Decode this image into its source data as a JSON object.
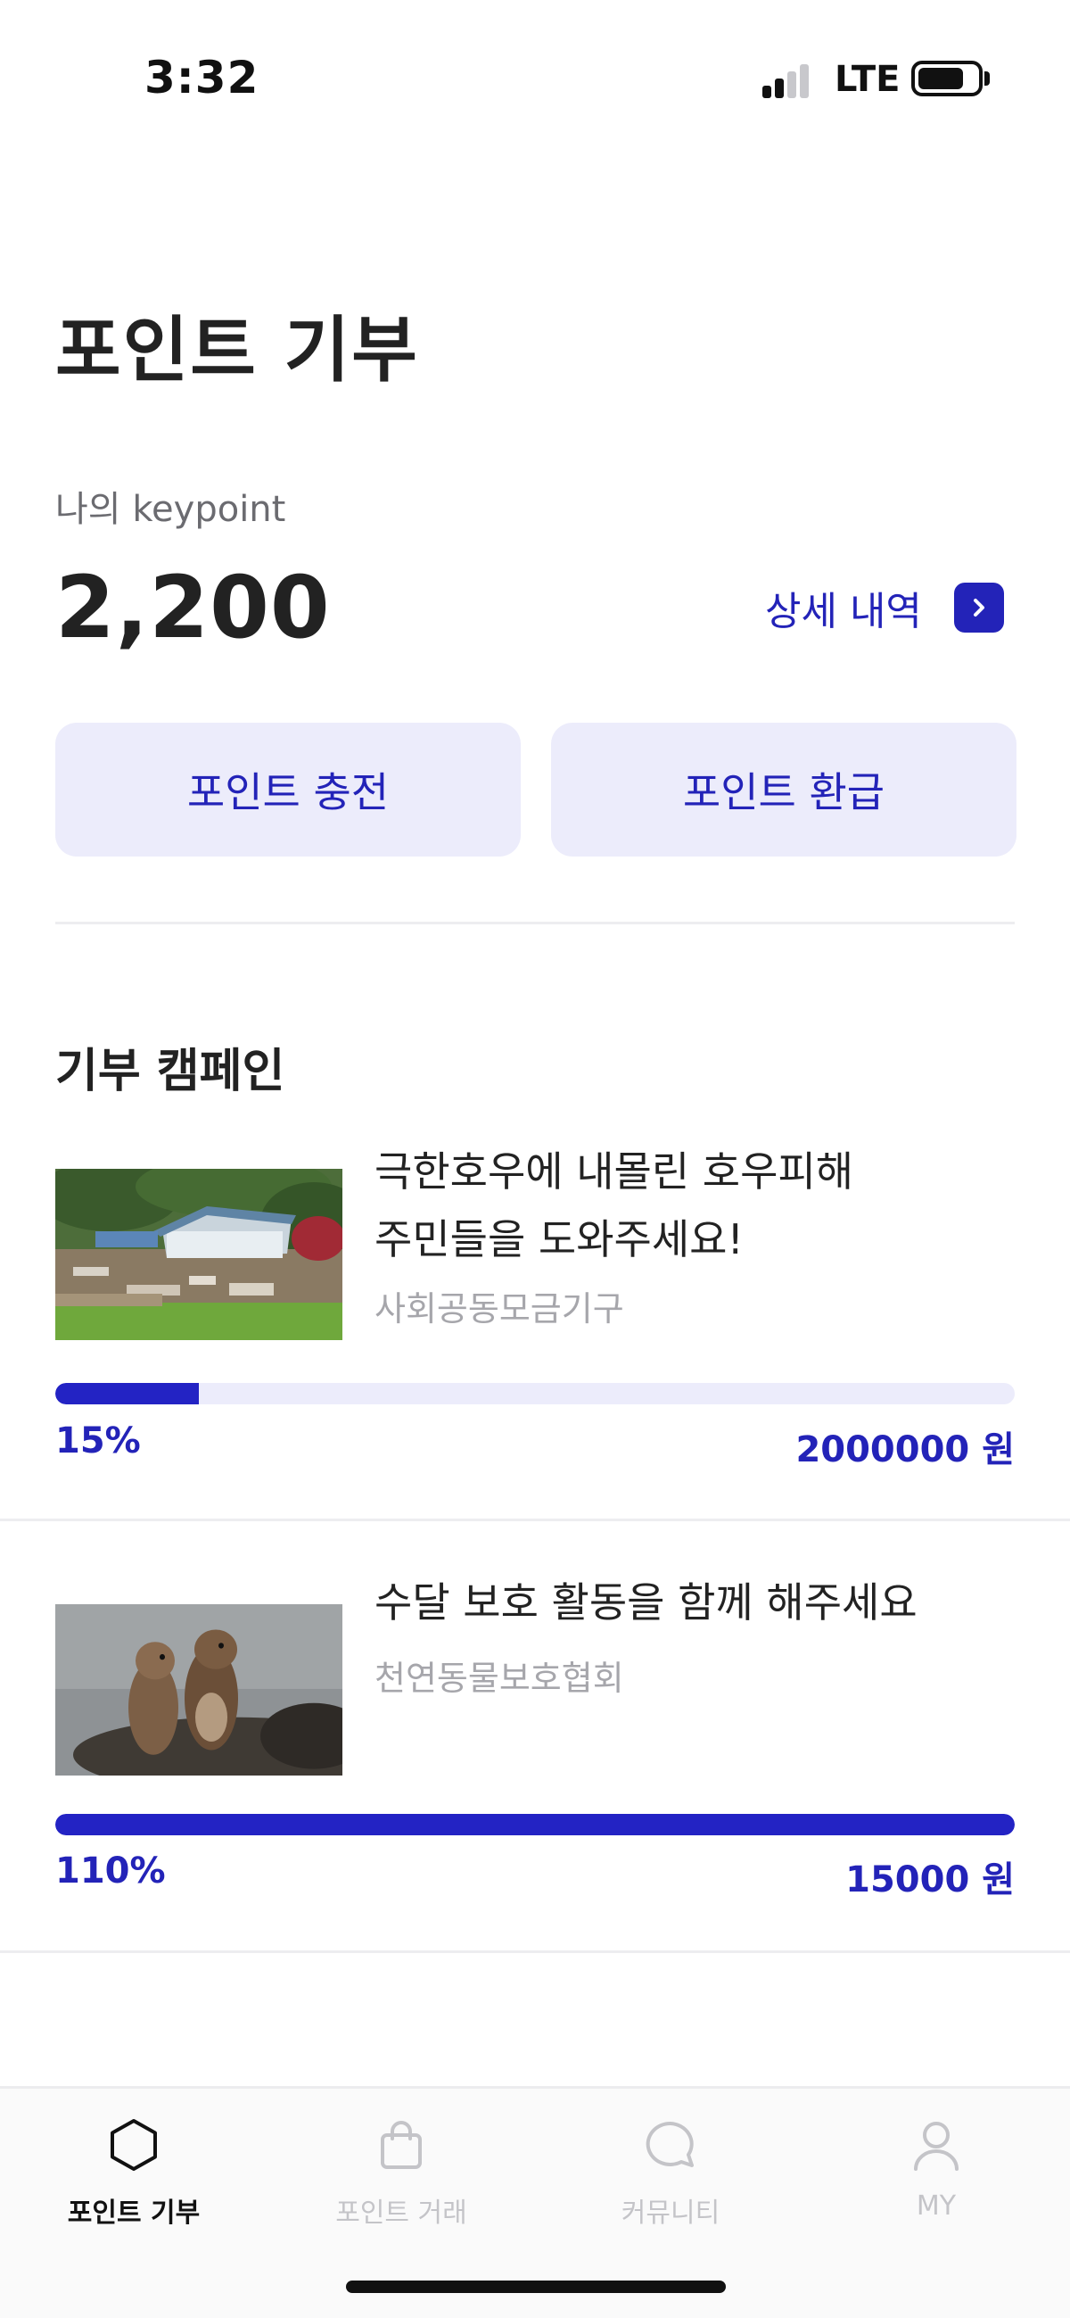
{
  "status_bar": {
    "time": "3:32",
    "network": "LTE"
  },
  "page": {
    "title": "포인트 기부"
  },
  "balance": {
    "label": "나의 keypoint",
    "value": "2,200",
    "detail_label": "상세 내역"
  },
  "actions": {
    "charge_label": "포인트 충전",
    "refund_label": "포인트 환급"
  },
  "campaigns_section": {
    "title": "기부 캠페인",
    "items": [
      {
        "title_line1": "극한호우에 내몰린 호우피해",
        "title_line2": "주민들을 도와주세요!",
        "org": "사회공동모금기구",
        "progress_fraction": 0.15,
        "percent_label": "15%",
        "goal_label": "2000000 원"
      },
      {
        "title_line1": "수달 보호 활동을 함께 해주세요",
        "org": "천연동물보호협회",
        "progress_fraction": 1.0,
        "percent_label": "110%",
        "goal_label": "15000 원"
      }
    ]
  },
  "tab_bar": {
    "tabs": [
      {
        "label": "포인트 기부",
        "icon": "hexagon-icon",
        "active": true
      },
      {
        "label": "포인트 거래",
        "icon": "shopping-bag-icon",
        "active": false
      },
      {
        "label": "커뮤니티",
        "icon": "chat-bubble-icon",
        "active": false
      },
      {
        "label": "MY",
        "icon": "user-icon",
        "active": false
      }
    ]
  },
  "colors": {
    "accent": "#2323b8",
    "accent_light": "#ececfb",
    "text": "#222222",
    "muted": "#a6a6ab"
  }
}
